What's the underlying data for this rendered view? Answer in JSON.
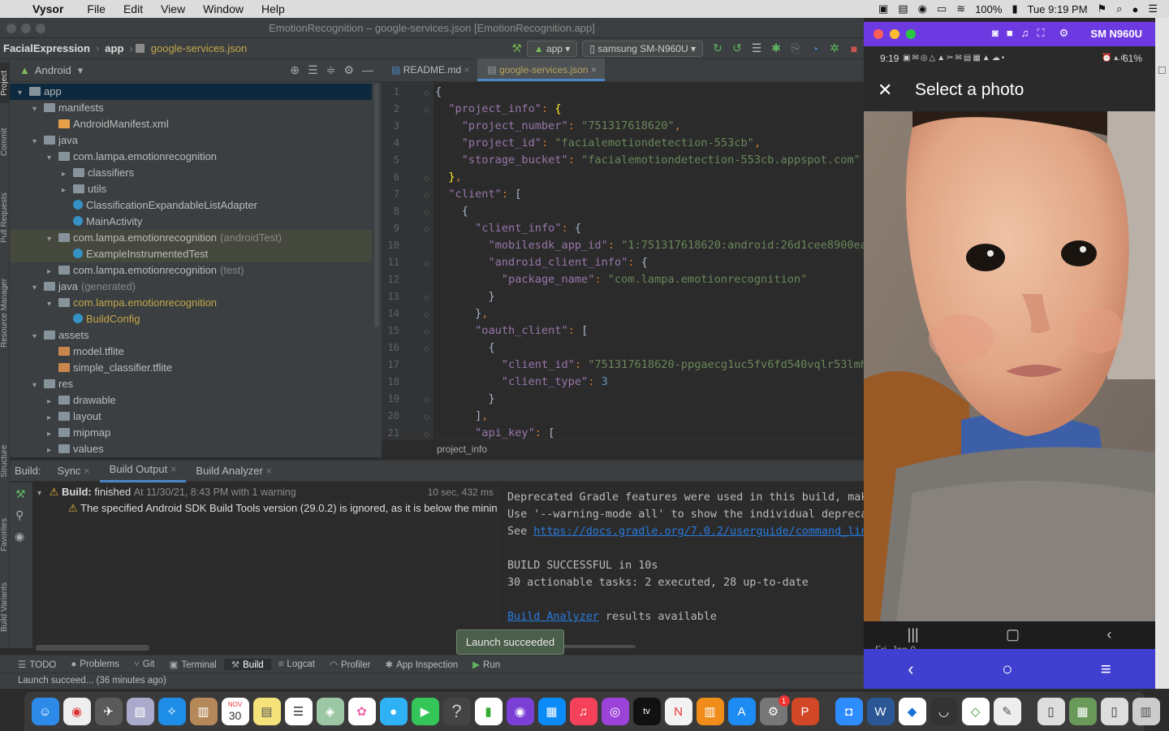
{
  "menubar": {
    "app_name": "Vysor",
    "items": [
      "File",
      "Edit",
      "View",
      "Window",
      "Help"
    ],
    "battery": "100%",
    "clock": "Tue 9:19 PM"
  },
  "window": {
    "title": "EmotionRecognition – google-services.json [EmotionRecognition.app]"
  },
  "navbar": {
    "crumbs": [
      "FacialExpression",
      "app",
      "google-services.json"
    ],
    "run_config": "app",
    "device": "samsung SM-N960U"
  },
  "side_tabs": [
    "Project",
    "Commit",
    "Pull Requests",
    "Resource Manager",
    "Structure",
    "Favorites",
    "Build Variants"
  ],
  "project": {
    "view": "Android",
    "tree": [
      {
        "label": "app",
        "depth": 0,
        "arrow": "▾",
        "icon": "folder",
        "selected": true
      },
      {
        "label": "manifests",
        "depth": 1,
        "arrow": "▾",
        "icon": "folder"
      },
      {
        "label": "AndroidManifest.xml",
        "depth": 2,
        "arrow": "",
        "icon": "xml"
      },
      {
        "label": "java",
        "depth": 1,
        "arrow": "▾",
        "icon": "folder"
      },
      {
        "label": "com.lampa.emotionrecognition",
        "depth": 2,
        "arrow": "▾",
        "icon": "pkg"
      },
      {
        "label": "classifiers",
        "depth": 3,
        "arrow": "▸",
        "icon": "pkg"
      },
      {
        "label": "utils",
        "depth": 3,
        "arrow": "▸",
        "icon": "pkg"
      },
      {
        "label": "ClassificationExpandableListAdapter",
        "depth": 3,
        "arrow": "",
        "icon": "class"
      },
      {
        "label": "MainActivity",
        "depth": 3,
        "arrow": "",
        "icon": "class"
      },
      {
        "label": "com.lampa.emotionrecognition",
        "suffix": "(androidTest)",
        "depth": 2,
        "arrow": "▾",
        "icon": "pkg",
        "highlight": true
      },
      {
        "label": "ExampleInstrumentedTest",
        "depth": 3,
        "arrow": "",
        "icon": "class",
        "highlight": true
      },
      {
        "label": "com.lampa.emotionrecognition",
        "suffix": "(test)",
        "depth": 2,
        "arrow": "▸",
        "icon": "pkg"
      },
      {
        "label": "java",
        "suffix": "(generated)",
        "depth": 1,
        "arrow": "▾",
        "icon": "folder"
      },
      {
        "label": "com.lampa.emotionrecognition",
        "depth": 2,
        "arrow": "▾",
        "icon": "pkg",
        "yellow": true
      },
      {
        "label": "BuildConfig",
        "depth": 3,
        "arrow": "",
        "icon": "class",
        "yellow": true
      },
      {
        "label": "assets",
        "depth": 1,
        "arrow": "▾",
        "icon": "folder"
      },
      {
        "label": "model.tflite",
        "depth": 2,
        "arrow": "",
        "icon": "tflite"
      },
      {
        "label": "simple_classifier.tflite",
        "depth": 2,
        "arrow": "",
        "icon": "tflite"
      },
      {
        "label": "res",
        "depth": 1,
        "arrow": "▾",
        "icon": "folder"
      },
      {
        "label": "drawable",
        "depth": 2,
        "arrow": "▸",
        "icon": "folder"
      },
      {
        "label": "layout",
        "depth": 2,
        "arrow": "▸",
        "icon": "folder"
      },
      {
        "label": "mipmap",
        "depth": 2,
        "arrow": "▸",
        "icon": "folder"
      },
      {
        "label": "values",
        "depth": 2,
        "arrow": "▸",
        "icon": "folder"
      }
    ]
  },
  "editor": {
    "tabs": [
      {
        "label": "README.md",
        "active": false
      },
      {
        "label": "google-services.json",
        "active": true
      }
    ],
    "lines": [
      "{",
      "  \"project_info\": {",
      "    \"project_number\": \"751317618620\",",
      "    \"project_id\": \"facialemotiondetection-553cb\",",
      "    \"storage_bucket\": \"facialemotiondetection-553cb.appspot.com\"",
      "  },",
      "  \"client\": [",
      "    {",
      "      \"client_info\": {",
      "        \"mobilesdk_app_id\": \"1:751317618620:android:26d1cee8900ea5",
      "        \"android_client_info\": {",
      "          \"package_name\": \"com.lampa.emotionrecognition\"",
      "        }",
      "      },",
      "      \"oauth_client\": [",
      "        {",
      "          \"client_id\": \"751317618620-ppgaecg1uc5fv6fd540vqlr53lmhk",
      "          \"client_type\": 3",
      "        }",
      "      ],",
      "      \"api_key\": ["
    ],
    "breadcrumb": "project_info"
  },
  "build": {
    "label": "Build:",
    "tabs": [
      "Sync",
      "Build Output",
      "Build Analyzer"
    ],
    "finished_bold": "Build:",
    "finished_text": "finished",
    "finished_meta": "At 11/30/21, 8:43 PM with 1 warning",
    "duration": "10 sec, 432 ms",
    "warning": "The specified Android SDK Build Tools version (29.0.2) is ignored, as it is below the minin",
    "output": [
      "Deprecated Gradle features were used in this build, mak",
      "Use '--warning-mode all' to show the individual depreca",
      "See ",
      "",
      "BUILD SUCCESSFUL in 10s",
      "30 actionable tasks: 2 executed, 28 up-to-date",
      "",
      " results available"
    ],
    "output_link": "https://docs.gradle.org/7.0.2/userguide/command_lin",
    "analyzer_link": "Build Analyzer"
  },
  "toolwindows": [
    "TODO",
    "Problems",
    "Git",
    "Terminal",
    "Build",
    "Logcat",
    "Profiler",
    "App Inspection",
    "Run"
  ],
  "toast": "Launch succeeded",
  "status": "Launch succeed... (36 minutes ago)",
  "phone": {
    "window_title": "SM N960U",
    "time": "9:19",
    "battery": "61%",
    "picker_title": "Select a photo",
    "partial_text": "Fri, Jan 0"
  },
  "dock": {
    "calendar_month": "NOV",
    "calendar_day": "30",
    "badge": "1"
  },
  "colors": {
    "accent": "#4a88c7",
    "vysor_purple": "#6d3ae2",
    "vysor_nav": "#3f3fd0",
    "toast_bg": "#4b5d4b"
  }
}
